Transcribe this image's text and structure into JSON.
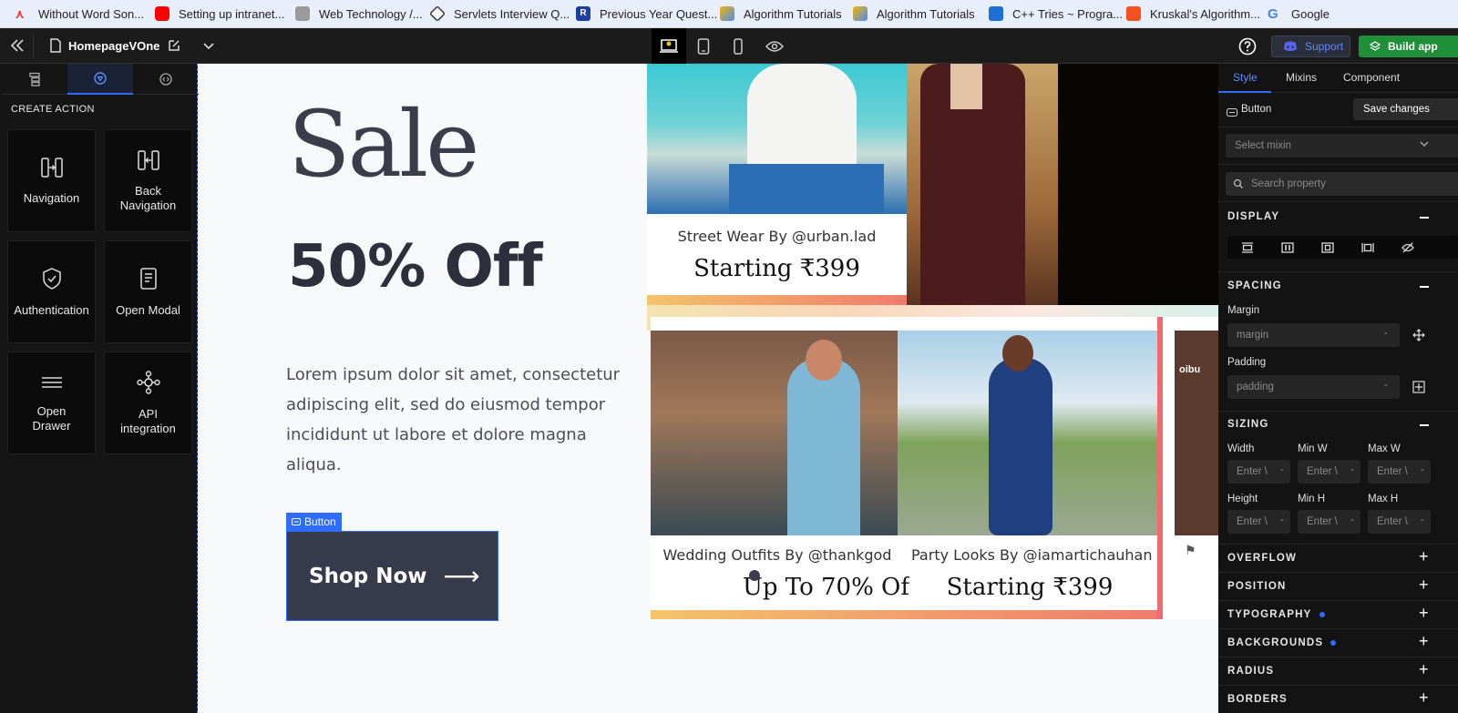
{
  "bookmarks": [
    {
      "label": "Without Word Son...",
      "color": "#e8453c"
    },
    {
      "label": "Setting up intranet...",
      "color": "#ff0000"
    },
    {
      "label": "Web Technology /...",
      "color": "#8a8a8a"
    },
    {
      "label": "Servlets Interview Q...",
      "color": "#444444"
    },
    {
      "label": "Previous Year Quest...",
      "color": "#1d3fa0"
    },
    {
      "label": "Algorithm Tutorials",
      "color": "#f2b600"
    },
    {
      "label": "Algorithm Tutorials",
      "color": "#f2b600"
    },
    {
      "label": "C++ Tries ~ Progra...",
      "color": "#1e6fd6"
    },
    {
      "label": "Kruskal's Algorithm...",
      "color": "#f4511e"
    },
    {
      "label": "Google",
      "color": "#4285f4"
    }
  ],
  "topbar": {
    "page_name": "HomepageVOne",
    "support_label": "Support",
    "build_label": "Build app"
  },
  "left_panel": {
    "section_title": "CREATE ACTION",
    "actions": [
      {
        "label": "Navigation",
        "icon": "navigation-icon"
      },
      {
        "label": "Back Navigation",
        "icon": "back-navigation-icon"
      },
      {
        "label": "Authentication",
        "icon": "shield-check-icon"
      },
      {
        "label": "Open Modal",
        "icon": "modal-icon"
      },
      {
        "label": "Open Drawer",
        "icon": "drawer-icon"
      },
      {
        "label": "API integration",
        "icon": "api-icon"
      }
    ]
  },
  "canvas": {
    "sale_title": "Sale",
    "discount": "50% Off",
    "body_text": "Lorem ipsum dolor sit amet, consectetur adipiscing elit, sed do eiusmod tempor incididunt ut labore et dolore magna aliqua.",
    "selection_tag": "Button",
    "shop_button": "Shop Now",
    "shop_arrow": "⟶",
    "promo_cards": [
      {
        "caption": "Street Wear By @urban.lad",
        "price": "Starting ₹399"
      },
      {
        "caption": "Wedding Outfits By @thankgod",
        "price": "Up To 70% Of"
      },
      {
        "caption": "Party Looks By @iamartichauhan",
        "price": "Starting ₹399"
      }
    ],
    "brand_logo_text": "oibu"
  },
  "right_panel": {
    "tabs": [
      "Style",
      "Mixins",
      "Component"
    ],
    "element_label": "Button",
    "save_label": "Save changes",
    "mixin_placeholder": "Select mixin",
    "search_placeholder": "Search property",
    "sections": {
      "display": "DISPLAY",
      "spacing": "SPACING",
      "sizing": "SIZING",
      "overflow": "OVERFLOW",
      "position": "POSITION",
      "typography": "TYPOGRAPHY",
      "backgrounds": "BACKGROUNDS",
      "radius": "RADIUS",
      "borders": "BORDERS"
    },
    "margin_label": "Margin",
    "margin_placeholder": "margin",
    "padding_label": "Padding",
    "padding_placeholder": "padding",
    "sizing_labels": [
      "Width",
      "Min W",
      "Max W",
      "Height",
      "Min H",
      "Max H"
    ],
    "enter_placeholder": "Enter \\",
    "accent_color": "#2f6cff"
  }
}
